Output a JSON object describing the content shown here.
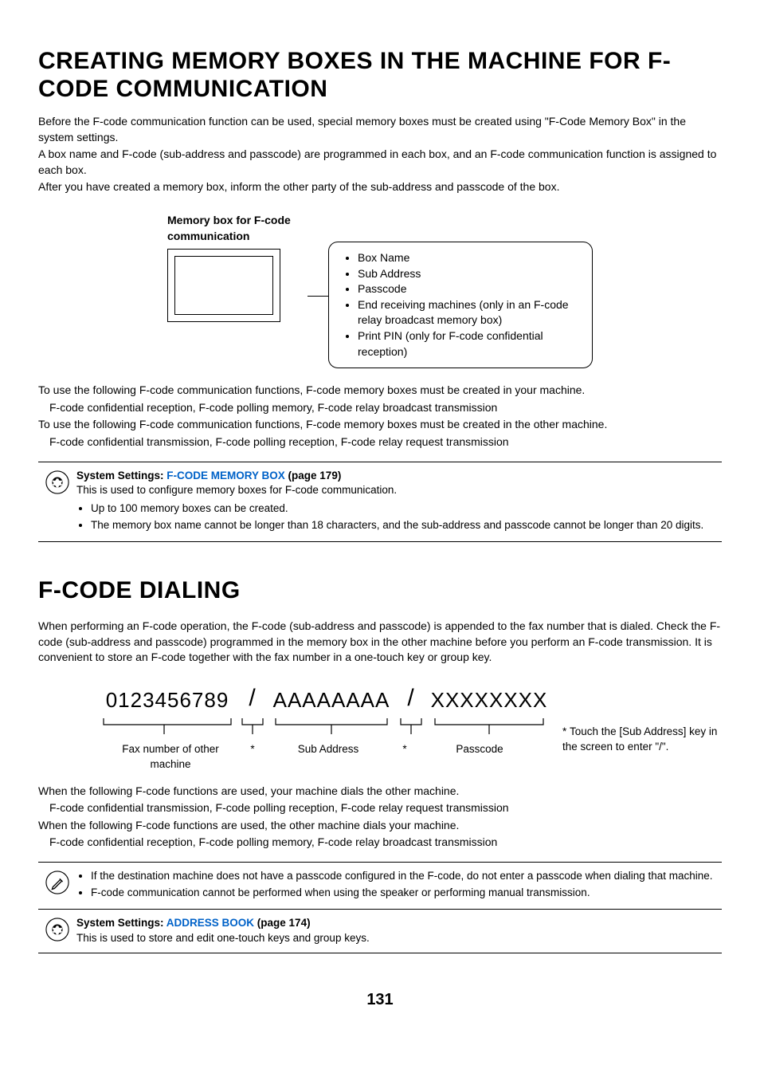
{
  "h1": "CREATING MEMORY BOXES IN THE MACHINE FOR F-CODE COMMUNICATION",
  "intro1": "Before the F-code communication function can be used, special memory boxes must be created using \"F-Code Memory Box\" in the system settings.",
  "intro2": "A box name and F-code (sub-address and passcode) are programmed in each box, and an F-code communication function is assigned to each box.",
  "intro3": "After you have created a memory box, inform the other party of the sub-address and passcode of the box.",
  "diag1": {
    "caption": "Memory box for F-code communication",
    "items": [
      "Box Name",
      "Sub Address",
      "Passcode",
      "End receiving machines (only in an F-code relay broadcast memory box)",
      "Print PIN (only for F-code confidential reception)"
    ]
  },
  "use1a": "To use the following F-code communication functions, F-code memory boxes must be created in your machine.",
  "use1b": "F-code confidential reception, F-code polling memory, F-code relay broadcast transmission",
  "use2a": "To use the following F-code communication functions, F-code memory boxes must be created in the other machine.",
  "use2b": "F-code confidential transmission, F-code polling reception, F-code relay request transmission",
  "callout1": {
    "title_prefix": "System Settings: ",
    "link": "F-CODE MEMORY BOX",
    "title_suffix": " (page 179)",
    "desc": "This is used to configure memory boxes for F-code communication.",
    "bullets": [
      "Up to 100 memory boxes can be created.",
      "The memory box name cannot be longer than 18 characters, and the sub-address and passcode cannot be longer than 20 digits."
    ]
  },
  "h2": "F-CODE DIALING",
  "dial_intro": "When performing an F-code operation, the F-code (sub-address and passcode) is appended to the fax number that is dialed. Check the F-code (sub-address and passcode) programmed in the memory box in the other machine before you perform an F-code transmission. It is convenient to store an F-code together with the fax number in a one-touch key or group key.",
  "diag2": {
    "fax": "0123456789",
    "slash": "/",
    "sub": "AAAAAAAA",
    "pass": "XXXXXXXX",
    "lbl_fax": "Fax number of other machine",
    "lbl_sub": "Sub Address",
    "lbl_pass": "Passcode",
    "star": "*",
    "footnote_marker": "*",
    "footnote": "Touch the [Sub Address] key in the screen to enter \"/\"."
  },
  "func1a": "When the following F-code functions are used, your machine dials the other machine.",
  "func1b": "F-code confidential transmission, F-code polling reception, F-code relay request transmission",
  "func2a": "When the following F-code functions are used, the other machine dials your machine.",
  "func2b": "F-code confidential reception, F-code polling memory, F-code relay broadcast transmission",
  "callout2": {
    "bullets": [
      "If the destination machine does not have a passcode configured in the F-code, do not enter a passcode when dialing that machine.",
      "F-code communication cannot be performed when using the speaker or performing manual transmission."
    ]
  },
  "callout3": {
    "title_prefix": "System Settings: ",
    "link": "ADDRESS BOOK",
    "title_suffix": " (page 174)",
    "desc": "This is used to store and edit one-touch keys and group keys."
  },
  "page_number": "131"
}
